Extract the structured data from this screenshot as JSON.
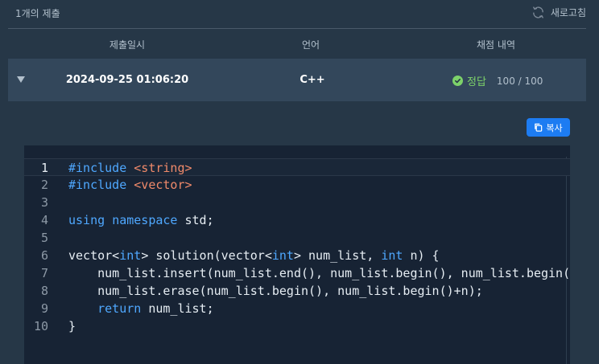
{
  "header": {
    "submission_count": "1개의 제출",
    "refresh_label": "새로고침"
  },
  "table": {
    "columns": [
      "제출일시",
      "언어",
      "채점 내역"
    ],
    "row": {
      "datetime": "2024-09-25 01:06:20",
      "language": "C++",
      "status": "정답",
      "score": "100 / 100"
    }
  },
  "copy_button_label": "복사",
  "code": {
    "language": "cpp",
    "active_line": 1,
    "lines": [
      "#include <string>",
      "#include <vector>",
      "",
      "using namespace std;",
      "",
      "vector<int> solution(vector<int> num_list, int n) {",
      "    num_list.insert(num_list.end(), num_list.begin(), num_list.begin()+n);",
      "    num_list.erase(num_list.begin(), num_list.begin()+n);",
      "    return num_list;",
      "}"
    ]
  },
  "colors": {
    "background": "#263747",
    "row_background": "#33475b",
    "editor_background": "#172334",
    "accent": "#1d7cf2",
    "success": "#7dd26a"
  },
  "icons": [
    "refresh-icon",
    "caret-down-icon",
    "check-circle-icon",
    "copy-icon"
  ]
}
